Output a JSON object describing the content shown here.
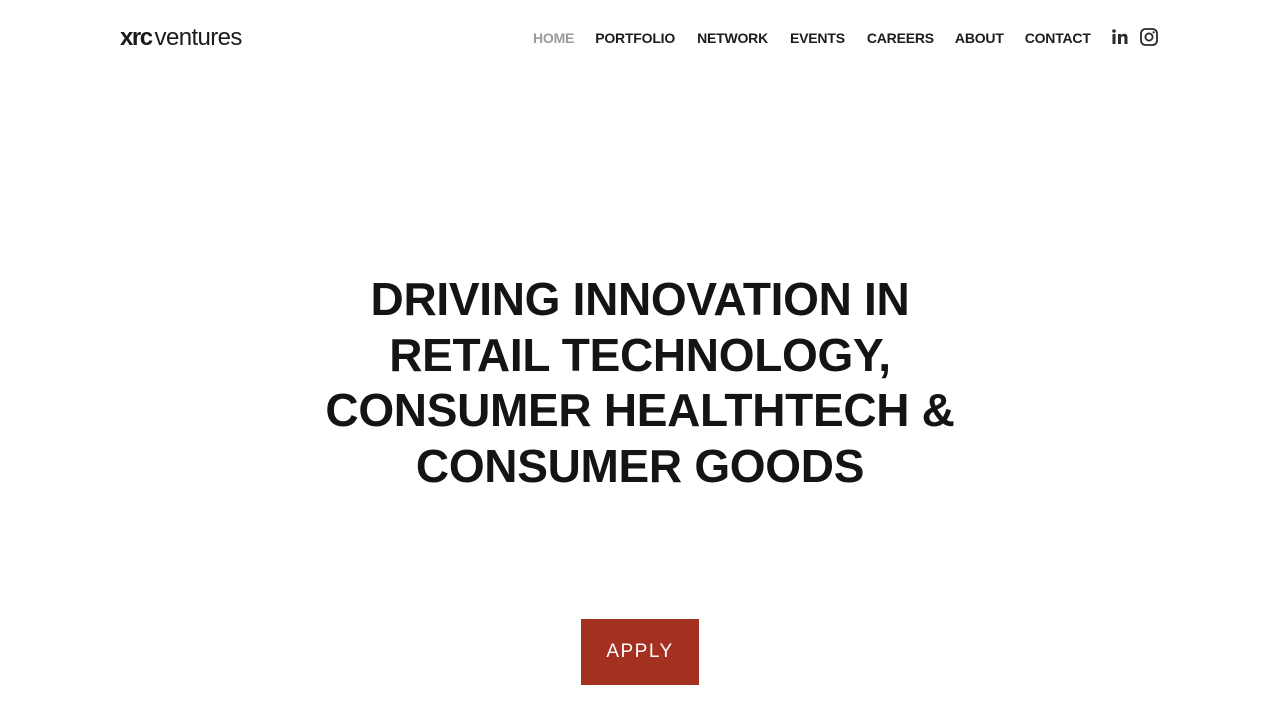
{
  "brand": {
    "logo_bold": "xrc",
    "logo_light": "ventures"
  },
  "nav": {
    "items": [
      {
        "label": "HOME",
        "active": true
      },
      {
        "label": "PORTFOLIO",
        "active": false
      },
      {
        "label": "NETWORK",
        "active": false
      },
      {
        "label": "EVENTS",
        "active": false
      },
      {
        "label": "CAREERS",
        "active": false
      },
      {
        "label": "ABOUT",
        "active": false
      },
      {
        "label": "CONTACT",
        "active": false
      }
    ]
  },
  "social": {
    "icons": [
      "linkedin-icon",
      "instagram-icon"
    ]
  },
  "hero": {
    "title": "DRIVING INNOVATION IN RETAIL TECHNOLOGY, CONSUMER HEALTHTECH & CONSUMER GOODS"
  },
  "cta": {
    "apply_label": "APPLY"
  },
  "colors": {
    "accent": "#a33020",
    "nav_active": "#9a9a9a",
    "text": "#141414"
  }
}
